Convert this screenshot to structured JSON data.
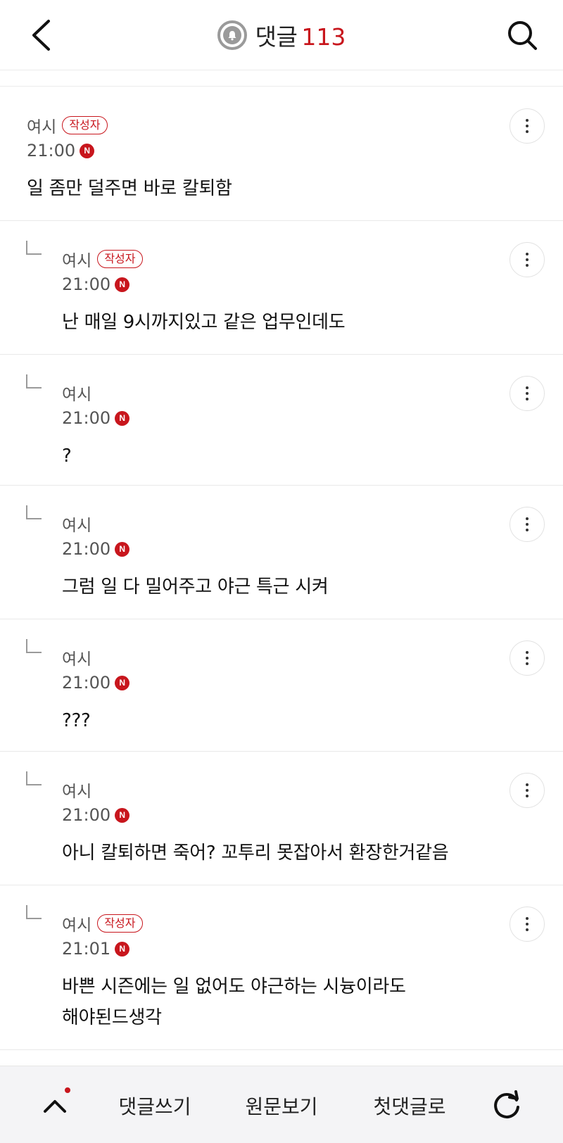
{
  "header": {
    "back_icon": "chevron-left-icon",
    "bell_icon": "bell-icon",
    "title": "댓글",
    "count": "113",
    "search_icon": "search-icon"
  },
  "colors": {
    "accent": "#c8161d",
    "muted": "#555555"
  },
  "comments": [
    {
      "author": "여시",
      "badge": "작성자",
      "time": "21:00",
      "new": "N",
      "text": "일 좀만 덜주면 바로 칼퇴함"
    },
    {
      "author": "여시",
      "badge": "작성자",
      "time": "21:00",
      "new": "N",
      "text": "난 매일 9시까지있고 같은 업무인데도"
    },
    {
      "author": "여시",
      "time": "21:00",
      "new": "N",
      "text": "?"
    },
    {
      "author": "여시",
      "time": "21:00",
      "new": "N",
      "text": "그럼 일 다 밀어주고 야근 특근 시켜"
    },
    {
      "author": "여시",
      "time": "21:00",
      "new": "N",
      "text": "???"
    },
    {
      "author": "여시",
      "time": "21:00",
      "new": "N",
      "text": "아니 칼퇴하면 죽어? 꼬투리 못잡아서 환장한거같음"
    },
    {
      "author": "여시",
      "badge": "작성자",
      "time": "21:01",
      "new": "N",
      "text_line1": "바쁜 시즌에는 일 없어도 야근하는 시늉이라도",
      "text_line2": "해야된드생각"
    }
  ],
  "footer": {
    "up_icon": "chevron-up-icon",
    "write": "댓글쓰기",
    "original": "원문보기",
    "first": "첫댓글로",
    "refresh_icon": "refresh-icon"
  }
}
